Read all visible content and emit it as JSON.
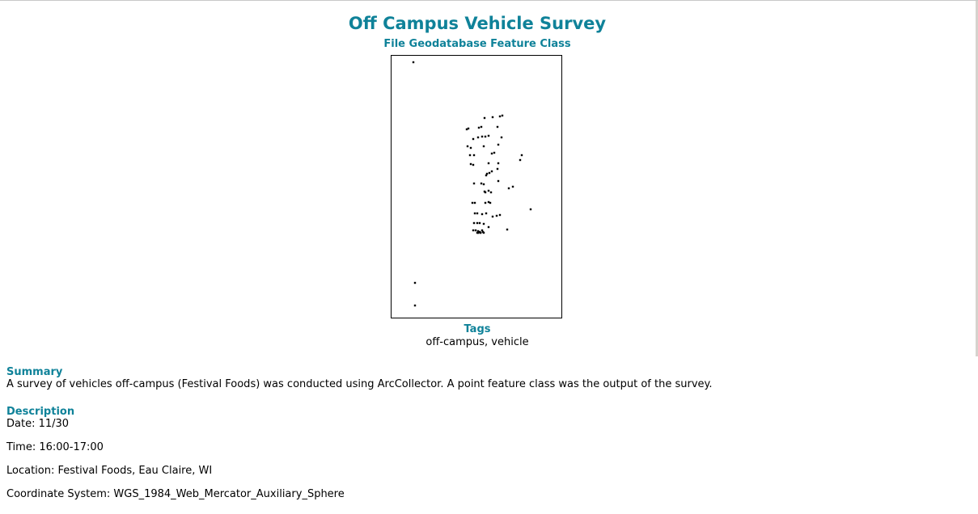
{
  "title": "Off Campus Vehicle Survey",
  "subtitle": "File Geodatabase Feature Class",
  "thumbnail": {
    "point_count": 78
  },
  "tags": {
    "heading": "Tags",
    "value": "off-campus, vehicle"
  },
  "summary": {
    "heading": "Summary",
    "text": "A survey of vehicles off-campus (Festival Foods) was conducted using ArcCollector. A point feature class was the output of the survey."
  },
  "description": {
    "heading": "Description",
    "lines": [
      "Date: 11/30",
      "Time: 16:00-17:00",
      "Location: Festival Foods, Eau Claire, WI",
      "Coordinate System: WGS_1984_Web_Mercator_Auxiliary_Sphere"
    ]
  },
  "colors": {
    "heading": "#0f8299",
    "text": "#000000",
    "border": "#000000"
  }
}
